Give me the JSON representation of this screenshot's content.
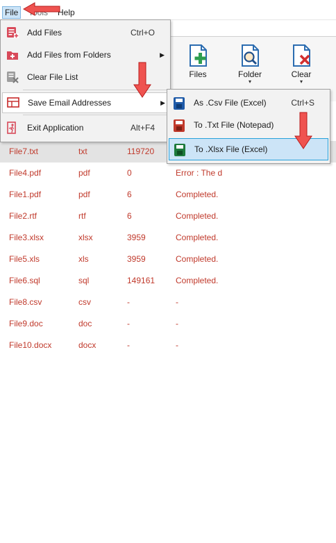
{
  "menubar": {
    "file": "File",
    "tools": "Tools",
    "help": "Help"
  },
  "ribbon": {
    "files_label": "Files",
    "folder_label": "Folder",
    "clear_label": "Clear",
    "dropdown_glyph": "▾"
  },
  "file_menu": {
    "items": [
      {
        "label": "Add Files",
        "shortcut": "Ctrl+O",
        "icon": "add-files-icon"
      },
      {
        "label": "Add Files from Folders",
        "shortcut": "",
        "icon": "add-folder-icon"
      },
      {
        "label": "Clear File List",
        "shortcut": "",
        "icon": "clear-list-icon"
      },
      {
        "label": "Save Email Addresses",
        "shortcut": "",
        "icon": "save-email-icon"
      },
      {
        "label": "Exit Application",
        "shortcut": "Alt+F4",
        "icon": "exit-icon"
      }
    ],
    "submenu_glyph": "▶"
  },
  "save_submenu": {
    "items": [
      {
        "label": "As .Csv File (Excel)",
        "shortcut": "Ctrl+S",
        "icon": "csv-save-icon"
      },
      {
        "label": "To .Txt File (Notepad)",
        "shortcut": "",
        "icon": "txt-save-icon"
      },
      {
        "label": "To .Xlsx File (Excel)",
        "shortcut": "",
        "icon": "xlsx-save-icon"
      }
    ]
  },
  "file_list": {
    "rows": [
      {
        "name": "File7.txt",
        "type": "txt",
        "count": "119720",
        "status": ""
      },
      {
        "name": "File4.pdf",
        "type": "pdf",
        "count": "0",
        "status": "Error : The d"
      },
      {
        "name": "File1.pdf",
        "type": "pdf",
        "count": "6",
        "status": "Completed."
      },
      {
        "name": "File2.rtf",
        "type": "rtf",
        "count": "6",
        "status": "Completed."
      },
      {
        "name": "File3.xlsx",
        "type": "xlsx",
        "count": "3959",
        "status": "Completed."
      },
      {
        "name": "File5.xls",
        "type": "xls",
        "count": "3959",
        "status": "Completed."
      },
      {
        "name": "File6.sql",
        "type": "sql",
        "count": "149161",
        "status": "Completed."
      },
      {
        "name": "File8.csv",
        "type": "csv",
        "count": "-",
        "status": "-"
      },
      {
        "name": "File9.doc",
        "type": "doc",
        "count": "-",
        "status": "-"
      },
      {
        "name": "File10.docx",
        "type": "docx",
        "count": "-",
        "status": "-"
      }
    ]
  },
  "colors": {
    "row_text": "#c0392b",
    "highlight": "#cce4f7",
    "arrow_red": "#e53935"
  }
}
